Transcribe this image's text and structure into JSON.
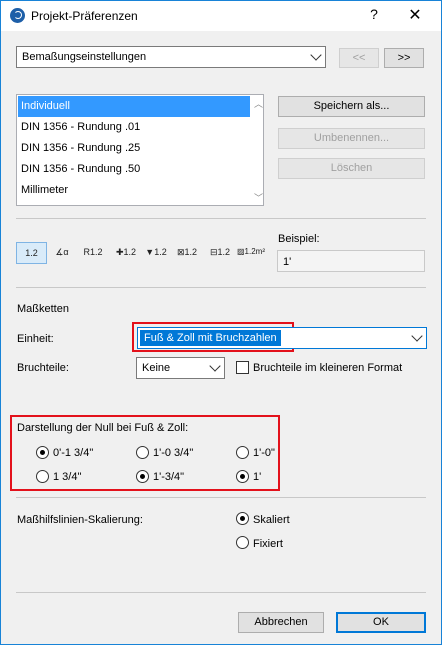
{
  "window": {
    "title": "Projekt-Präferenzen",
    "help": "?",
    "close": "✕"
  },
  "page_combo": {
    "value": "Bemaßungseinstellungen"
  },
  "nav": {
    "prev": "<<",
    "next": ">>"
  },
  "presets": {
    "items": [
      "Individuell",
      "DIN 1356 - Rundung .01",
      "DIN 1356 - Rundung .25",
      "DIN 1356 - Rundung .50",
      "Millimeter"
    ],
    "selected_index": 0
  },
  "actions": {
    "save_as": "Speichern als...",
    "rename": "Umbenennen...",
    "delete": "Löschen"
  },
  "dimension_types": {
    "items": [
      {
        "icon": "linear-dimension-icon",
        "glyph": "1.2"
      },
      {
        "icon": "angle-dimension-icon",
        "glyph": "∡α"
      },
      {
        "icon": "radius-dimension-icon",
        "glyph": "R1.2"
      },
      {
        "icon": "level-dimension-icon",
        "glyph": "✚1.2"
      },
      {
        "icon": "elevation-dimension-icon",
        "glyph": "▼1.2"
      },
      {
        "icon": "door-window-dimension-icon",
        "glyph": "⊠1.2"
      },
      {
        "icon": "sill-height-dimension-icon",
        "glyph": "⊟1.2"
      },
      {
        "icon": "area-dimension-icon",
        "glyph": "▨1.2m²"
      }
    ],
    "active_index": 0
  },
  "example": {
    "label": "Beispiel:",
    "value": "1'"
  },
  "chains": {
    "heading": "Maßketten",
    "unit_label": "Einheit:",
    "unit_value": "Fuß & Zoll mit Bruchzahlen",
    "fractions_label": "Bruchteile:",
    "fractions_value": "Keine",
    "smaller_format_label": "Bruchteile im kleineren Format",
    "smaller_format_checked": false
  },
  "zero_display": {
    "heading": "Darstellung der Null bei Fuß & Zoll:",
    "options": [
      "0'-1 3/4\"",
      "1'-0 3/4\"",
      "1'-0\"",
      "1 3/4\"",
      "1'-3/4\"",
      "1'"
    ],
    "selected": [
      0,
      4,
      5
    ]
  },
  "extension_scaling": {
    "label": "Maßhilfslinien-Skalierung:",
    "options": [
      "Skaliert",
      "Fixiert"
    ],
    "selected_index": 0
  },
  "footer": {
    "cancel": "Abbrechen",
    "ok": "OK"
  }
}
